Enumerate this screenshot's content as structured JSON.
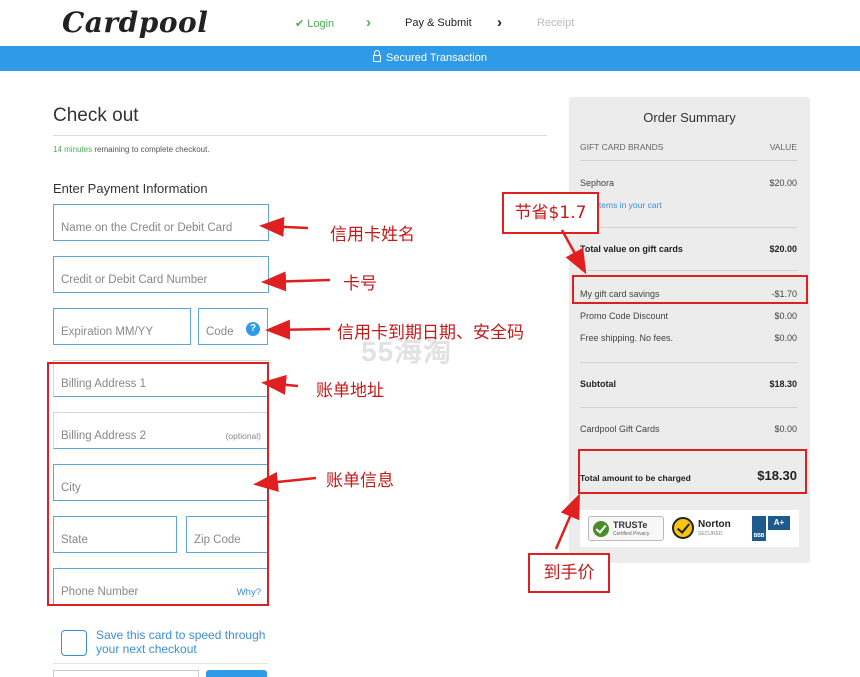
{
  "brand": {
    "logo_text": "Cardpool"
  },
  "steps": {
    "login": "Login",
    "pay_submit": "Pay & Submit",
    "receipt": "Receipt"
  },
  "secure_bar": {
    "label": "Secured Transaction"
  },
  "checkout": {
    "title": "Check out",
    "timer_minutes": "14 minutes",
    "timer_rest": "remaining to complete checkout.",
    "payment_title": "Enter Payment Information"
  },
  "form": {
    "name_on_card": "Name on the Credit or Debit Card",
    "card_number": "Credit or Debit Card Number",
    "expiration": "Expiration MM/YY",
    "code": "Code",
    "code_help": "?",
    "billing_address_1": "Billing Address 1",
    "billing_address_2": "Billing Address 2",
    "optional": "(optional)",
    "city": "City",
    "state": "State",
    "zip": "Zip Code",
    "phone": "Phone Number",
    "why": "Why?",
    "save_card": "Save this card to speed through your next checkout"
  },
  "summary": {
    "title": "Order Summary",
    "col_brands": "GIFT CARD BRANDS",
    "col_value": "VALUE",
    "brand_name": "Sephora",
    "brand_value": "$20.00",
    "edit_link": "Edit items in your cart",
    "total_value_label": "Total value on gift cards",
    "total_value": "$20.00",
    "savings_label": "My gift card savings",
    "savings_value": "-$1.70",
    "promo_label": "Promo Code Discount",
    "promo_value": "$0.00",
    "shipping_label": "Free shipping. No fees.",
    "shipping_value": "$0.00",
    "subtotal_label": "Subtotal",
    "subtotal_value": "$18.30",
    "gift_cards_label": "Cardpool Gift Cards",
    "gift_cards_value": "$0.00",
    "charged_label": "Total amount to be charged",
    "charged_value": "$18.30",
    "badges": {
      "truste": "TRUSTe",
      "truste_sub": "Certified Privacy",
      "norton": "Norton",
      "norton_sub": "SECURED",
      "bbb": "BBB",
      "bbb_grade": "A+"
    }
  },
  "annotations": {
    "card_name": "信用卡姓名",
    "card_number": "卡号",
    "expiry_code": "信用卡到期日期、安全码",
    "billing_address": "账单地址",
    "billing_info": "账单信息",
    "savings": "节省$1.7",
    "final_price": "到手价"
  },
  "watermark": "55海淘",
  "colors": {
    "accent_blue": "#2f9be8",
    "success_green": "#4caf50",
    "annotation_red": "#e02020"
  }
}
